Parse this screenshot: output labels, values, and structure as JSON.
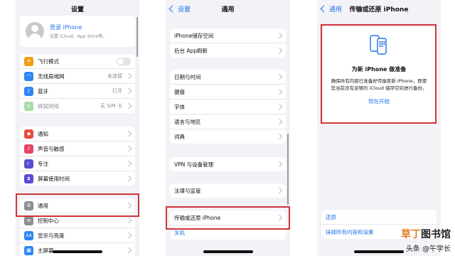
{
  "panel1": {
    "title": "设置",
    "profile": {
      "title": "登录 iPhone",
      "subtitle": "设置 iCloud、App Store等。"
    },
    "group1": [
      {
        "label": "飞行模式",
        "icon": "airplane-icon",
        "color": "#f39c12",
        "value": ""
      },
      {
        "label": "无线局域网",
        "icon": "wifi-icon",
        "color": "#2e86f5",
        "value": "未连接"
      },
      {
        "label": "蓝牙",
        "icon": "bluetooth-icon",
        "color": "#2e86f5",
        "value": "打开"
      },
      {
        "label": "蜂窝网络",
        "icon": "cellular-icon",
        "color": "#a8dba8",
        "value": "无 SIM 卡"
      }
    ],
    "group2": [
      {
        "label": "通知",
        "icon": "bell-icon",
        "color": "#e74c3c"
      },
      {
        "label": "声音与触感",
        "icon": "speaker-icon",
        "color": "#e84368"
      },
      {
        "label": "专注",
        "icon": "moon-icon",
        "color": "#5b4bd5"
      },
      {
        "label": "屏幕使用时间",
        "icon": "hourglass-icon",
        "color": "#5b4bd5"
      }
    ],
    "group3": [
      {
        "label": "通用",
        "icon": "gear-icon",
        "color": "#8e8e93"
      },
      {
        "label": "控制中心",
        "icon": "switches-icon",
        "color": "#8e8e93"
      },
      {
        "label": "显示与亮度",
        "icon": "text-size-icon",
        "color": "#2e86f5"
      },
      {
        "label": "主屏幕",
        "icon": "grid-icon",
        "color": "#2e86f5"
      }
    ]
  },
  "panel2": {
    "back": "设置",
    "title": "通用",
    "group1": [
      "iPhone储存空间",
      "后台 App刷新"
    ],
    "group2": [
      "日期与时间",
      "键盘",
      "字体",
      "语言与地区",
      "词典"
    ],
    "group3": [
      "VPN 与设备管理"
    ],
    "group4": [
      "法律与监管"
    ],
    "group5": [
      "传输或还原 iPhone",
      "关机"
    ]
  },
  "panel3": {
    "back": "通用",
    "title": "传输或还原 iPhone",
    "card": {
      "title": "为新 iPhone 做准备",
      "desc": "确保所有内容已准备好传输至新 iPhone，即使您当前没有足够的 iCloud 储存空间进行备份。",
      "link": "现在开始"
    },
    "actions": [
      "还原",
      "抹掉所有内容和设置"
    ]
  },
  "watermark": {
    "line1a": "草丁",
    "line1b": "图书馆",
    "line2": "头条 @午学长"
  }
}
